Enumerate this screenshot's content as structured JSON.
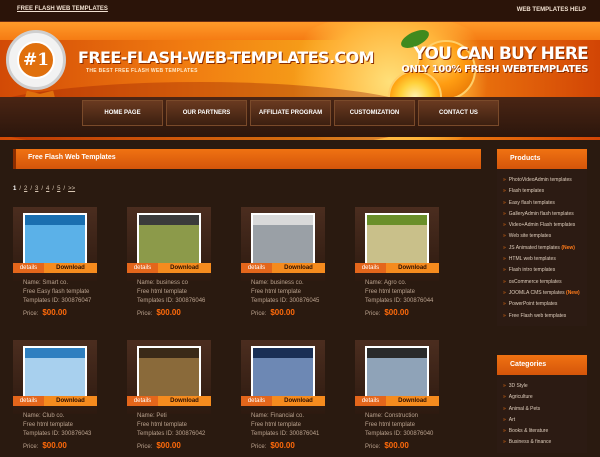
{
  "topbar": {
    "left_link": "FREE FLASH WEB TEMPLATES",
    "right_link": "WEB TEMPLATES HELP"
  },
  "header": {
    "badge": "#1",
    "logo": "FREE-FLASH-WEB-TEMPLATES.COM",
    "tagline": "THE BEST FREE FLASH WEB TEMPLATES",
    "buy_line1": "YOU CAN BUY HERE",
    "buy_line2": "ONLY 100% FRESH WEBTEMPLATES"
  },
  "nav": [
    "HOME PAGE",
    "OUR PARTNERS",
    "AFFILIATE PROGRAM",
    "CUSTOMIZATION",
    "CONTACT US"
  ],
  "main": {
    "title": "Free Flash Web Templates"
  },
  "pager": {
    "pages": [
      "1",
      "2",
      "3",
      "4",
      "5"
    ],
    "current": "1",
    "next": ">>"
  },
  "templates": [
    {
      "name": "Name: Smart co.",
      "type": "Free Easy flash template",
      "id": "Templates ID: 300876047",
      "price": "$00.00",
      "thumb": [
        "#1a6fb0",
        "#5bb1e8"
      ]
    },
    {
      "name": "Name: business co",
      "type": "Free html template",
      "id": "Templates ID: 300876046",
      "price": "$00.00",
      "thumb": [
        "#3b3b3b",
        "#8c9a4a"
      ]
    },
    {
      "name": "Name: business co.",
      "type": "Free html template",
      "id": "Templates ID: 300876045",
      "price": "$00.00",
      "thumb": [
        "#d9d9d9",
        "#9aa0a6"
      ]
    },
    {
      "name": "Name: Agro co.",
      "type": "Free html template",
      "id": "Templates ID: 300876044",
      "price": "$00.00",
      "thumb": [
        "#6a8f2a",
        "#c9c08a"
      ]
    },
    {
      "name": "Name: Club co.",
      "type": "Free html template",
      "id": "Templates ID: 300876043",
      "price": "$00.00",
      "thumb": [
        "#2f7fc0",
        "#a8d0ee"
      ]
    },
    {
      "name": "Name: Peti",
      "type": "Free html template",
      "id": "Templates ID: 300876042",
      "price": "$00.00",
      "thumb": [
        "#3a2a18",
        "#8a6a3a"
      ]
    },
    {
      "name": "Name: Financial co.",
      "type": "Free html template",
      "id": "Templates ID: 300876041",
      "price": "$00.00",
      "thumb": [
        "#1a2f55",
        "#6d88b4"
      ]
    },
    {
      "name": "Name: Construction",
      "type": "Free html template",
      "id": "Templates ID: 300876040",
      "price": "$00.00",
      "thumb": [
        "#2a2a2a",
        "#8fa3b8"
      ]
    }
  ],
  "buttons": {
    "details": "details",
    "download": "Download",
    "price_label": "Price:"
  },
  "products": {
    "title": "Products",
    "items": [
      {
        "label": "PhotoVideoAdmin templates",
        "new": ""
      },
      {
        "label": "Flash templates",
        "new": ""
      },
      {
        "label": "Easy flash templates",
        "new": ""
      },
      {
        "label": "GalleryAdmin flash templates",
        "new": ""
      },
      {
        "label": "Video+Admin Flash templates",
        "new": ""
      },
      {
        "label": "Web site templates",
        "new": ""
      },
      {
        "label": "JS Animated templates",
        "new": "(New)"
      },
      {
        "label": "HTML web templates",
        "new": ""
      },
      {
        "label": "Flash intro templates",
        "new": ""
      },
      {
        "label": "osCommerce templates",
        "new": ""
      },
      {
        "label": "JOOMLA CMS templates",
        "new": "(New)"
      },
      {
        "label": "PowerPoint templates",
        "new": ""
      },
      {
        "label": "Free Flash web templates",
        "new": ""
      }
    ]
  },
  "categories": {
    "title": "Categories",
    "items": [
      "3D Style",
      "Agriculture",
      "Animal & Pets",
      "Art",
      "Books & literature",
      "Business & finance"
    ]
  },
  "colors": {
    "accent": "#f07212",
    "price": "#ff6a0a",
    "background": "#2a1a10"
  }
}
